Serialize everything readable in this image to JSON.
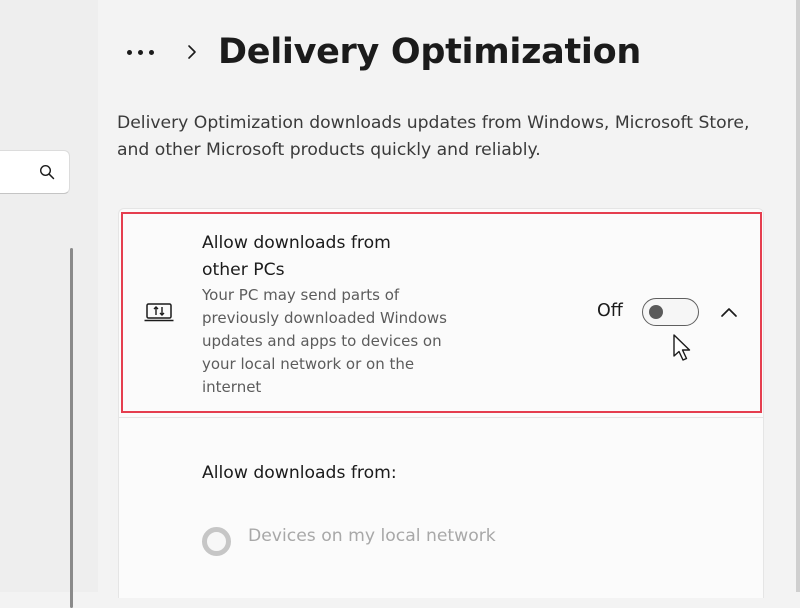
{
  "header": {
    "title": "Delivery Optimization",
    "more_icon": "more-horizontal-icon",
    "separator_icon": "chevron-right-icon"
  },
  "description": "Delivery Optimization downloads updates from Windows, Microsoft Store, and other Microsoft products quickly and reliably.",
  "nav": {
    "search_icon": "search-icon"
  },
  "setting": {
    "icon": "pc-transfer-icon",
    "title": "Allow downloads from other PCs",
    "description": "Your PC may send parts of previously downloaded Windows updates and apps to devices on your local network or on the internet",
    "toggle_label": "Off",
    "toggle_on": false,
    "expand_icon": "chevron-up-icon"
  },
  "expanded": {
    "heading": "Allow downloads from:",
    "options": [
      {
        "label": "Devices on my local network",
        "selected": false,
        "enabled": false
      }
    ]
  },
  "colors": {
    "highlight": "#e53e4f",
    "background": "#f3f3f3",
    "card": "#fbfbfb"
  }
}
